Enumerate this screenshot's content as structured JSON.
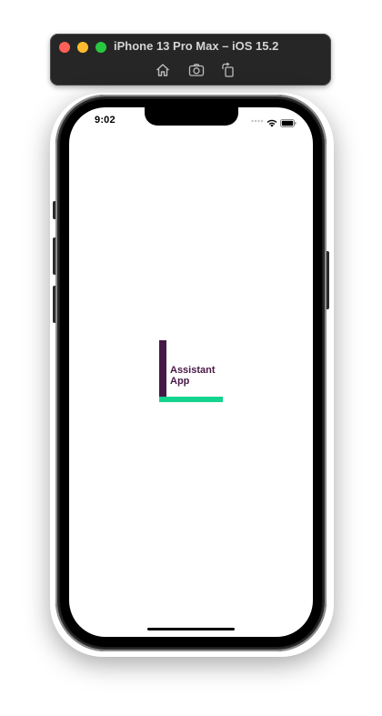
{
  "simulator": {
    "title": "iPhone 13 Pro Max – iOS 15.2",
    "tools": [
      "home-icon",
      "screenshot-icon",
      "rotate-icon"
    ]
  },
  "status_bar": {
    "time": "9:02",
    "icons": [
      "cellular-dots-icon",
      "wifi-icon",
      "battery-icon"
    ]
  },
  "splash": {
    "logo_line_1": "Assistant",
    "logo_line_2": "App"
  },
  "colors": {
    "brand_purple": "#461846",
    "brand_green": "#14d48f"
  }
}
